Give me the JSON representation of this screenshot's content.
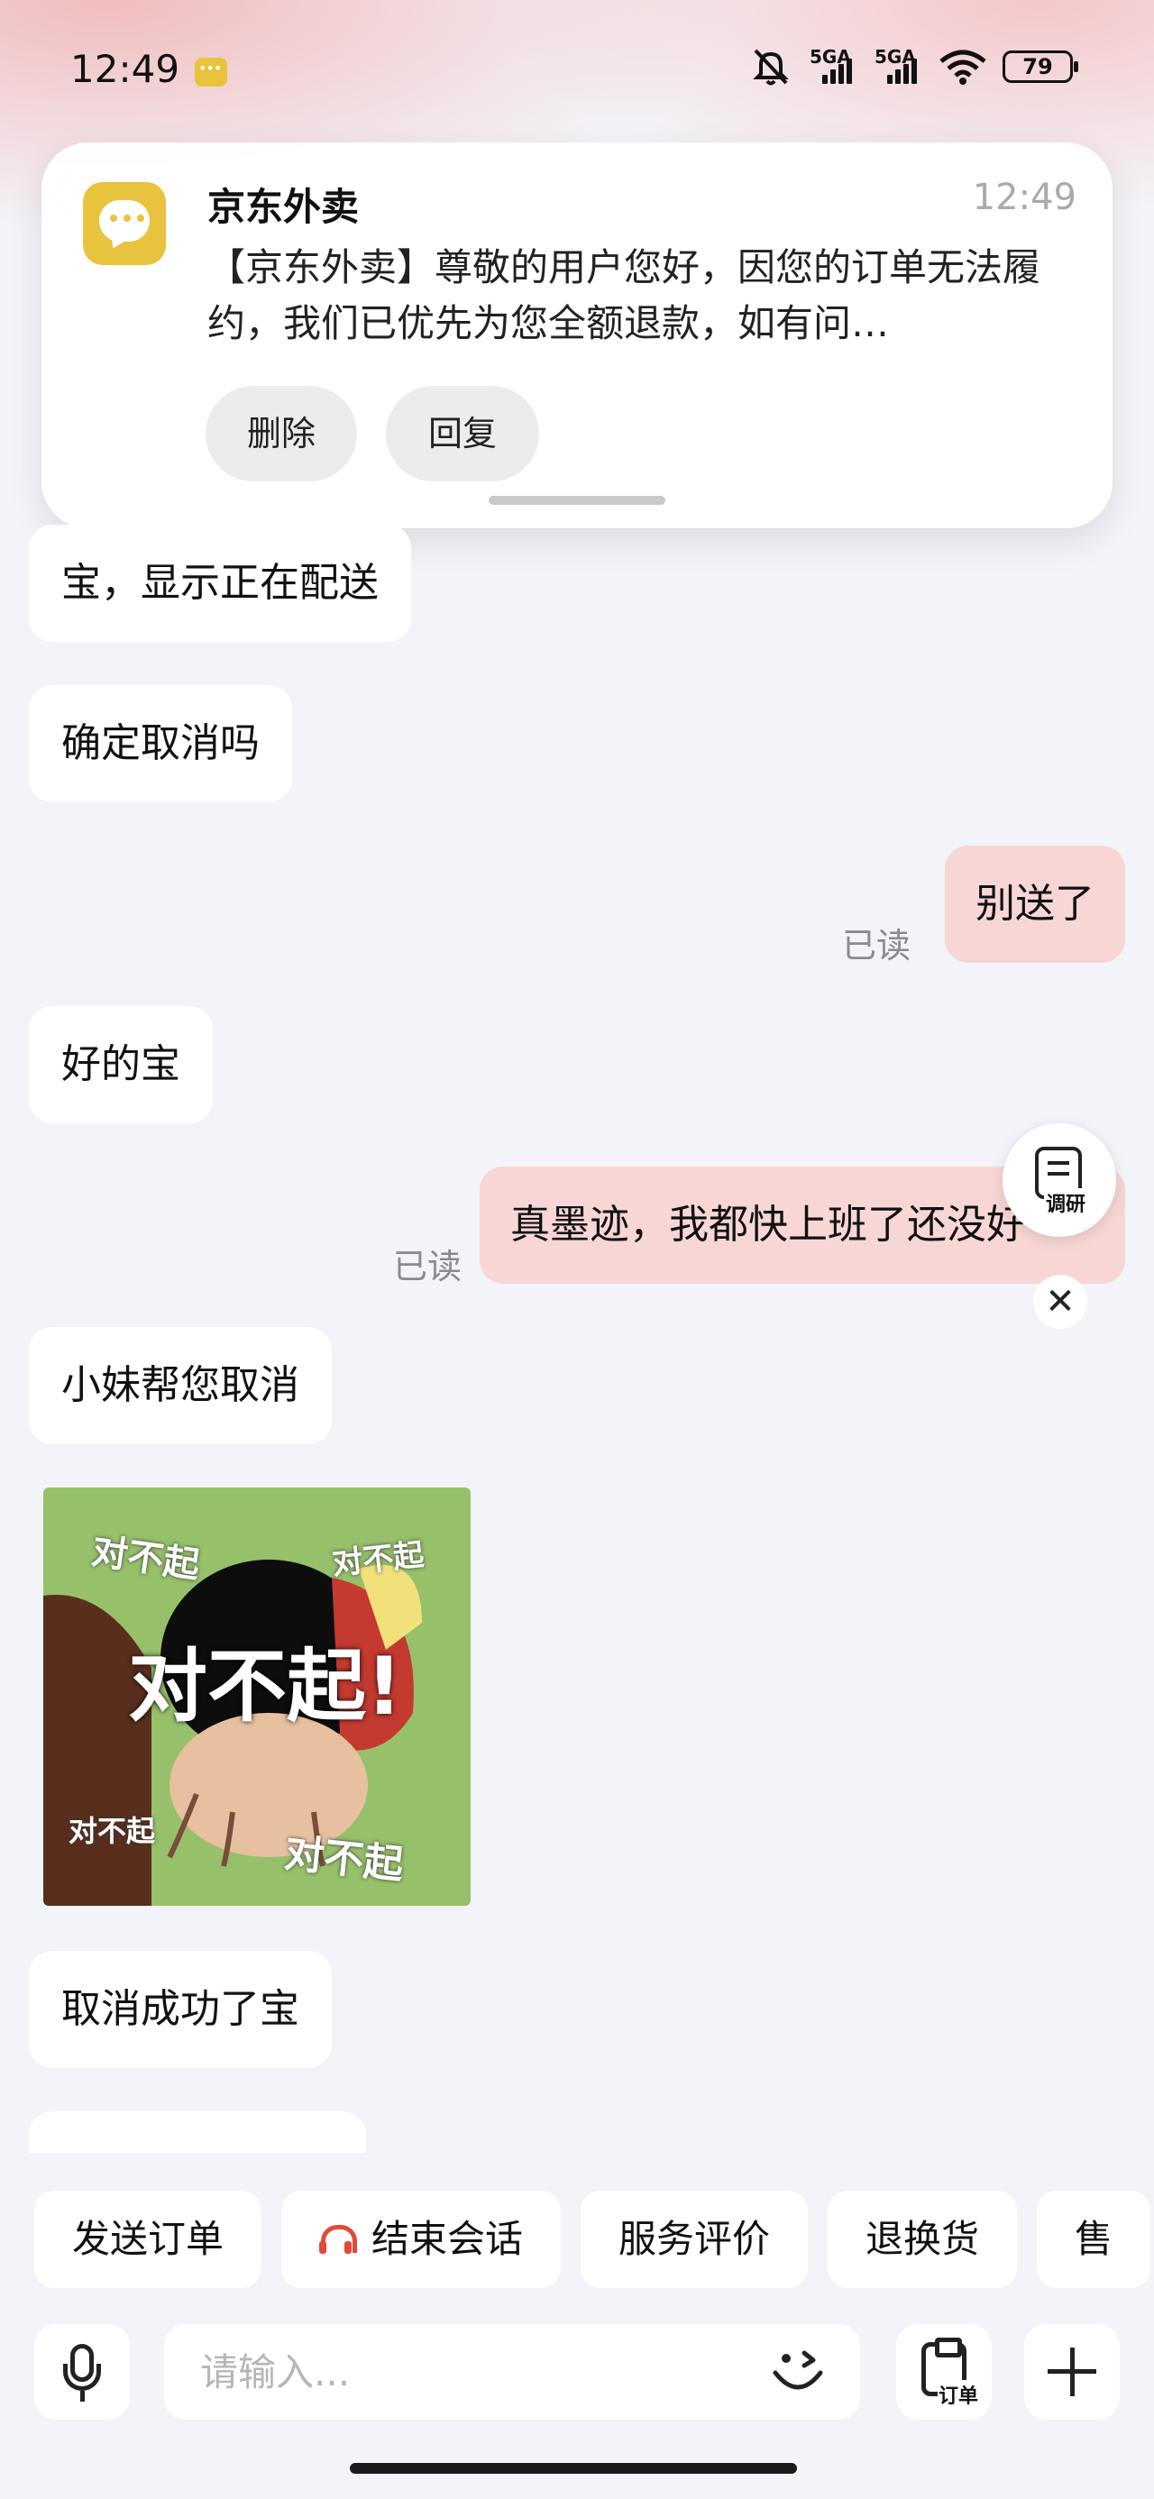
{
  "status_bar": {
    "time": "12:49",
    "network_1": "5GA",
    "network_2": "5GA",
    "battery": "79",
    "icons": [
      "notification-app-icon",
      "mute-icon",
      "signal-icon",
      "wifi-icon",
      "battery-icon"
    ]
  },
  "notification": {
    "app_name": "京东外卖",
    "time": "12:49",
    "body": "【京东外卖】尊敬的用户您好，因您的订单无法履约，我们已优先为您全额退款，如有问…",
    "actions": {
      "delete": "删除",
      "reply": "回复"
    }
  },
  "chat": {
    "messages": [
      {
        "side": "left",
        "text": "宝，显示正在配送"
      },
      {
        "side": "left",
        "text": "确定取消吗"
      },
      {
        "side": "right",
        "text": "别送了",
        "status": "已读"
      },
      {
        "side": "left",
        "text": "好的宝"
      },
      {
        "side": "right",
        "text": "真墨迹，我都快上班了还没好",
        "status": "已读"
      },
      {
        "side": "left",
        "text": "小妹帮您取消"
      },
      {
        "side": "left",
        "text": "取消成功了宝"
      }
    ],
    "sticker": {
      "main_text": "对不起!",
      "small_texts": [
        "对不起",
        "对不起",
        "对不起",
        "对不起"
      ]
    },
    "survey_label": "调研"
  },
  "quick_actions": [
    "发送订单",
    "结束会话",
    "服务评价",
    "退换货",
    "售"
  ],
  "input": {
    "placeholder": "请输入...",
    "order_label": "订单"
  },
  "colors": {
    "accent_pink": "#f8d6d6",
    "notification_icon": "#e8c33d",
    "headset_red": "#e24a36"
  }
}
